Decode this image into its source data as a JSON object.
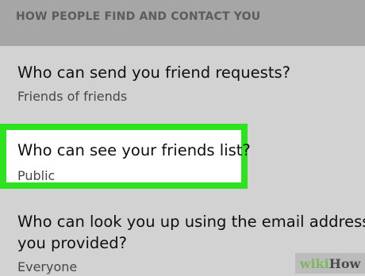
{
  "section": {
    "header": "HOW PEOPLE FIND AND CONTACT YOU"
  },
  "settings": [
    {
      "title": "Who can send you friend requests?",
      "value": "Friends of friends"
    },
    {
      "title": "Who can see your friends list?",
      "value": "Public",
      "highlighted": true,
      "highlight_color": "#2fe21f"
    },
    {
      "title_line1": "Who can look you up using the email address",
      "title_line2": "you provided?",
      "value": "Everyone"
    }
  ],
  "watermark": {
    "wiki": "wiki",
    "how": "How"
  },
  "colors": {
    "background": "#d2d2d2",
    "header_background": "#a6a6a6",
    "highlight": "#2fe21f"
  }
}
